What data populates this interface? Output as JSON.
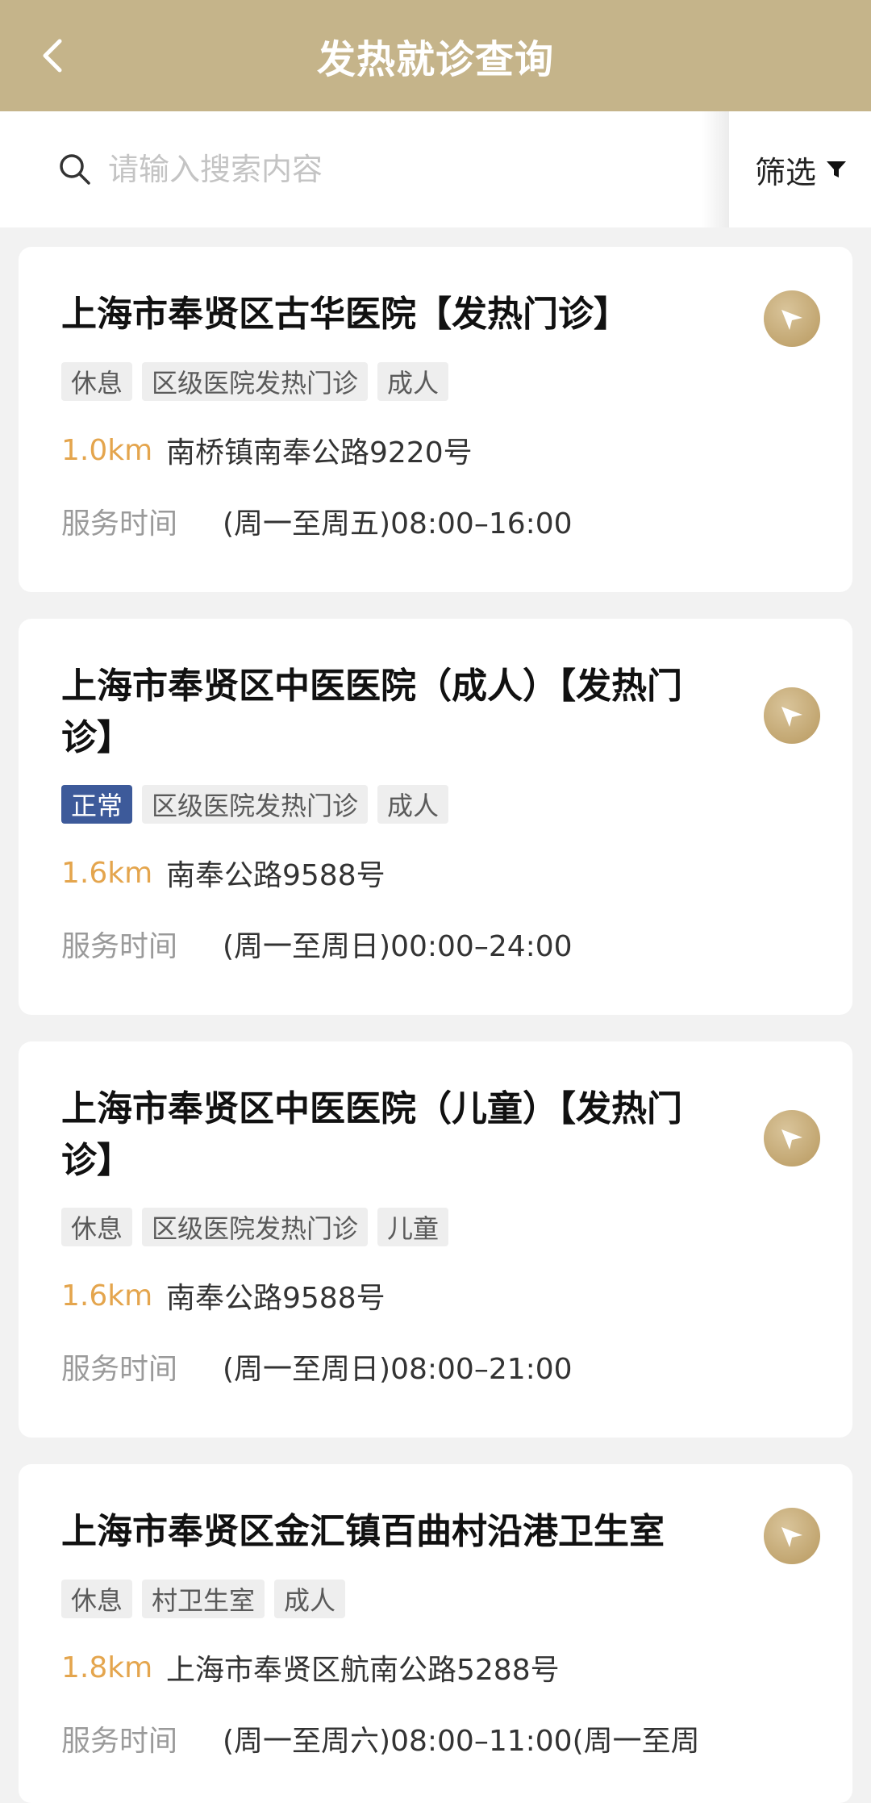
{
  "header": {
    "title": "发热就诊查询"
  },
  "search": {
    "placeholder": "请输入搜索内容"
  },
  "filter": {
    "label": "筛选"
  },
  "service_label": "服务时间",
  "colors": {
    "header_bg": "#c5b48a",
    "distance": "#e4a54d",
    "normal_tag": "#3d5a9a"
  },
  "clinics": [
    {
      "name": "上海市奉贤区古华医院【发热门诊】",
      "status": "休息",
      "type": "区级医院发热门诊",
      "group": "成人",
      "distance": "1.0km",
      "address": "南桥镇南奉公路9220号",
      "hours": "(周一至周五)08:00–16:00"
    },
    {
      "name": "上海市奉贤区中医医院（成人）【发热门诊】",
      "status": "正常",
      "type": "区级医院发热门诊",
      "group": "成人",
      "distance": "1.6km",
      "address": "南奉公路9588号",
      "hours": "(周一至周日)00:00–24:00"
    },
    {
      "name": "上海市奉贤区中医医院（儿童）【发热门诊】",
      "status": "休息",
      "type": "区级医院发热门诊",
      "group": "儿童",
      "distance": "1.6km",
      "address": "南奉公路9588号",
      "hours": "(周一至周日)08:00–21:00"
    },
    {
      "name": "上海市奉贤区金汇镇百曲村沿港卫生室",
      "status": "休息",
      "type": "村卫生室",
      "group": "成人",
      "distance": "1.8km",
      "address": "上海市奉贤区航南公路5288号",
      "hours": "(周一至周六)08:00–11:00(周一至周"
    }
  ]
}
